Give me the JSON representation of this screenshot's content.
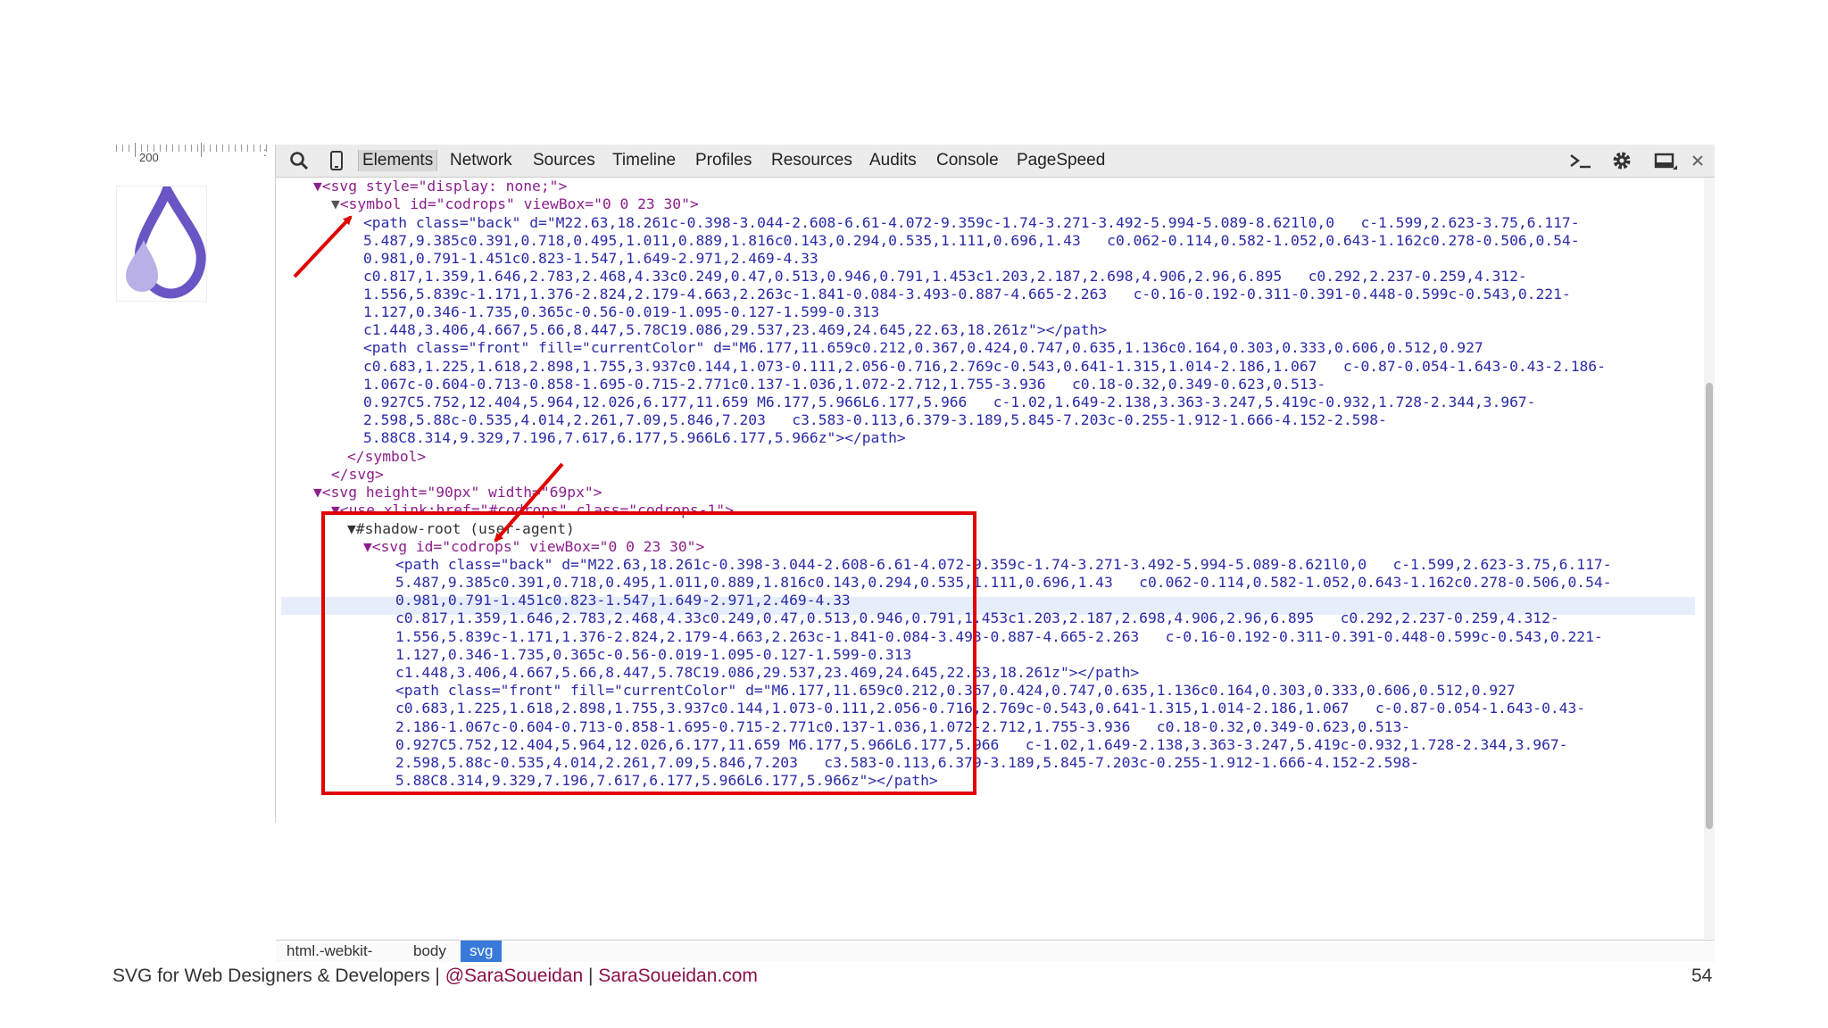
{
  "ruler": {
    "label": "200"
  },
  "devtools": {
    "tabs": [
      "Elements",
      "Network",
      "Sources",
      "Timeline",
      "Profiles",
      "Resources",
      "Audits",
      "Console",
      "PageSpeed"
    ],
    "active_tab": "Elements"
  },
  "code": {
    "l1": "▼<svg style=\"display: none;\">",
    "l2_t": "▼",
    "l2_a": "<symbol id=\"codrops\" viewBox=\"0 0 23 30\">",
    "l3": "<path class=\"back\" d=\"M22.63,18.261c-0.398-3.044-2.608-6.61-4.072-9.359c-1.74-3.271-3.492-5.994-5.089-8.621l0,0   c-1.599,2.623-3.75,6.117-",
    "l4": "5.487,9.385c0.391,0.718,0.495,1.011,0.889,1.816c0.143,0.294,0.535,1.111,0.696,1.43   c0.062-0.114,0.582-1.052,0.643-1.162c0.278-0.506,0.54-",
    "l5": "0.981,0.791-1.451c0.823-1.547,1.649-2.971,2.469-4.33",
    "l6": "c0.817,1.359,1.646,2.783,2.468,4.33c0.249,0.47,0.513,0.946,0.791,1.453c1.203,2.187,2.698,4.906,2.96,6.895   c0.292,2.237-0.259,4.312-",
    "l7": "1.556,5.839c-1.171,1.376-2.824,2.179-4.663,2.263c-1.841-0.084-3.493-0.887-4.665-2.263   c-0.16-0.192-0.311-0.391-0.448-0.599c-0.543,0.221-",
    "l8": "1.127,0.346-1.735,0.365c-0.56-0.019-1.095-0.127-1.599-0.313",
    "l9": "c1.448,3.406,4.667,5.66,8.447,5.78C19.086,29.537,23.469,24.645,22.63,18.261z\"></path>",
    "l10": "<path class=\"front\" fill=\"currentColor\" d=\"M6.177,11.659c0.212,0.367,0.424,0.747,0.635,1.136c0.164,0.303,0.333,0.606,0.512,0.927",
    "l11": "c0.683,1.225,1.618,2.898,1.755,3.937c0.144,1.073-0.111,2.056-0.716,2.769c-0.543,0.641-1.315,1.014-2.186,1.067   c-0.87-0.054-1.643-0.43-2.186-",
    "l12": "1.067c-0.604-0.713-0.858-1.695-0.715-2.771c0.137-1.036,1.072-2.712,1.755-3.936   c0.18-0.32,0.349-0.623,0.513-",
    "l13": "0.927C5.752,12.404,5.964,12.026,6.177,11.659 M6.177,5.966L6.177,5.966   c-1.02,1.649-2.138,3.363-3.247,5.419c-0.932,1.728-2.344,3.967-",
    "l14": "2.598,5.88c-0.535,4.014,2.261,7.09,5.846,7.203   c3.583-0.113,6.379-3.189,5.845-7.203c-0.255-1.912-1.666-4.152-2.598-",
    "l15": "5.88C8.314,9.329,7.196,7.617,6.177,5.966L6.177,5.966z\"></path>",
    "l16": "</symbol>",
    "l17": "</svg>",
    "l18": "▼<svg height=\"90px\" width=\"69px\">",
    "l19": "▼<use xlink:href=\"#codrops\" class=\"codrops-1\">",
    "l20": "▼#shadow-root (user-agent)",
    "l21": "▼<svg id=\"codrops\" viewBox=\"0 0 23 30\">",
    "l22": "<path class=\"back\" d=\"M22.63,18.261c-0.398-3.044-2.608-6.61-4.072-9.359c-1.74-3.271-3.492-5.994-5.089-8.621l0,0   c-1.599,2.623-3.75,6.117-",
    "l23": "5.487,9.385c0.391,0.718,0.495,1.011,0.889,1.816c0.143,0.294,0.535,1.111,0.696,1.43   c0.062-0.114,0.582-1.052,0.643-1.162c0.278-0.506,0.54-",
    "l24": "0.981,0.791-1.451c0.823-1.547,1.649-2.971,2.469-4.33",
    "l25": "c0.817,1.359,1.646,2.783,2.468,4.33c0.249,0.47,0.513,0.946,0.791,1.453c1.203,2.187,2.698,4.906,2.96,6.895   c0.292,2.237-0.259,4.312-",
    "l26": "1.556,5.839c-1.171,1.376-2.824,2.179-4.663,2.263c-1.841-0.084-3.493-0.887-4.665-2.263   c-0.16-0.192-0.311-0.391-0.448-0.599c-0.543,0.221-",
    "l27": "1.127,0.346-1.735,0.365c-0.56-0.019-1.095-0.127-1.599-0.313",
    "l28": "c1.448,3.406,4.667,5.66,8.447,5.78C19.086,29.537,23.469,24.645,22.63,18.261z\"></path>",
    "l29": "<path class=\"front\" fill=\"currentColor\" d=\"M6.177,11.659c0.212,0.367,0.424,0.747,0.635,1.136c0.164,0.303,0.333,0.606,0.512,0.927",
    "l30": "c0.683,1.225,1.618,2.898,1.755,3.937c0.144,1.073-0.111,2.056-0.716,2.769c-0.543,0.641-1.315,1.014-2.186,1.067   c-0.87-0.054-1.643-0.43-",
    "l31": "2.186-1.067c-0.604-0.713-0.858-1.695-0.715-2.771c0.137-1.036,1.072-2.712,1.755-3.936   c0.18-0.32,0.349-0.623,0.513-",
    "l32": "0.927C5.752,12.404,5.964,12.026,6.177,11.659 M6.177,5.966L6.177,5.966   c-1.02,1.649-2.138,3.363-3.247,5.419c-0.932,1.728-2.344,3.967-",
    "l33": "2.598,5.88c-0.535,4.014,2.261,7.09,5.846,7.203   c3.583-0.113,6.379-3.189,5.845-7.203c-0.255-1.912-1.666-4.152-2.598-",
    "l34": "5.88C8.314,9.329,7.196,7.617,6.177,5.966L6.177,5.966z\"></path>"
  },
  "breadcrumbs": [
    "html.-webkit-",
    "body",
    "svg"
  ],
  "footer": {
    "title": "SVG for Web Designers & Developers | ",
    "handle": "@SaraSoueidan",
    "sep": " | ",
    "site": "SaraSoueidan.com"
  },
  "page_number": "54",
  "colors": {
    "accent": "#3879d9",
    "highlight_box": "#e00000",
    "drop_light": "#b0a6e0",
    "drop_dark": "#6a55c4"
  }
}
